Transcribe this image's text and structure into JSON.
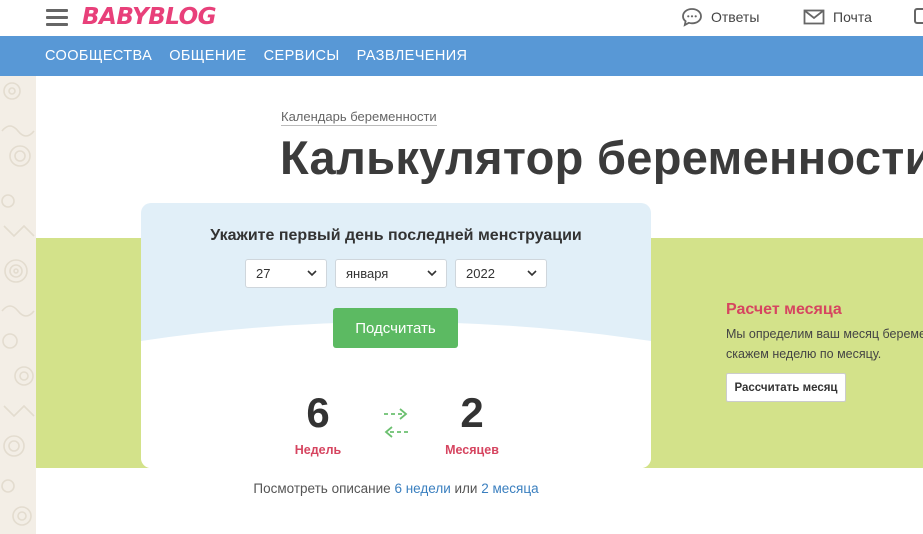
{
  "header": {
    "logo_text_1": "BABY",
    "logo_text_2": "BLOG",
    "answers_label": "Ответы",
    "mail_label": "Почта",
    "icons": {
      "menu": "hamburger-icon",
      "answers": "chat-bubble-icon",
      "mail": "envelope-icon"
    }
  },
  "nav": {
    "items": [
      "СООБЩЕСТВА",
      "ОБЩЕНИЕ",
      "СЕРВИСЫ",
      "РАЗВЛЕЧЕНИЯ"
    ]
  },
  "breadcrumb": "Календарь беременности",
  "page_title": "Калькулятор беременности",
  "calculator": {
    "heading": "Укажите первый день последней менструации",
    "day": "27",
    "month": "января",
    "year": "2022",
    "submit_label": "Подсчитать",
    "weeks_value": "6",
    "weeks_label": "Недель",
    "months_value": "2",
    "months_label": "Месяцев"
  },
  "description": {
    "prefix": "Посмотреть описание",
    "weeks_link": "6 недели",
    "middle": "или",
    "months_link": "2 месяца"
  },
  "month_panel": {
    "title": "Расчет месяца",
    "line1": "Мы определим ваш месяц беременности или",
    "line2": "скажем неделю по месяцу.",
    "button_label": "Рассчитать месяц"
  },
  "colors": {
    "brand_pink": "#e8407a",
    "nav_blue": "#5898d6",
    "band_green": "#d3e28a",
    "button_green": "#5cba62",
    "accent_red": "#d64560",
    "link_blue": "#3a7fbf"
  }
}
